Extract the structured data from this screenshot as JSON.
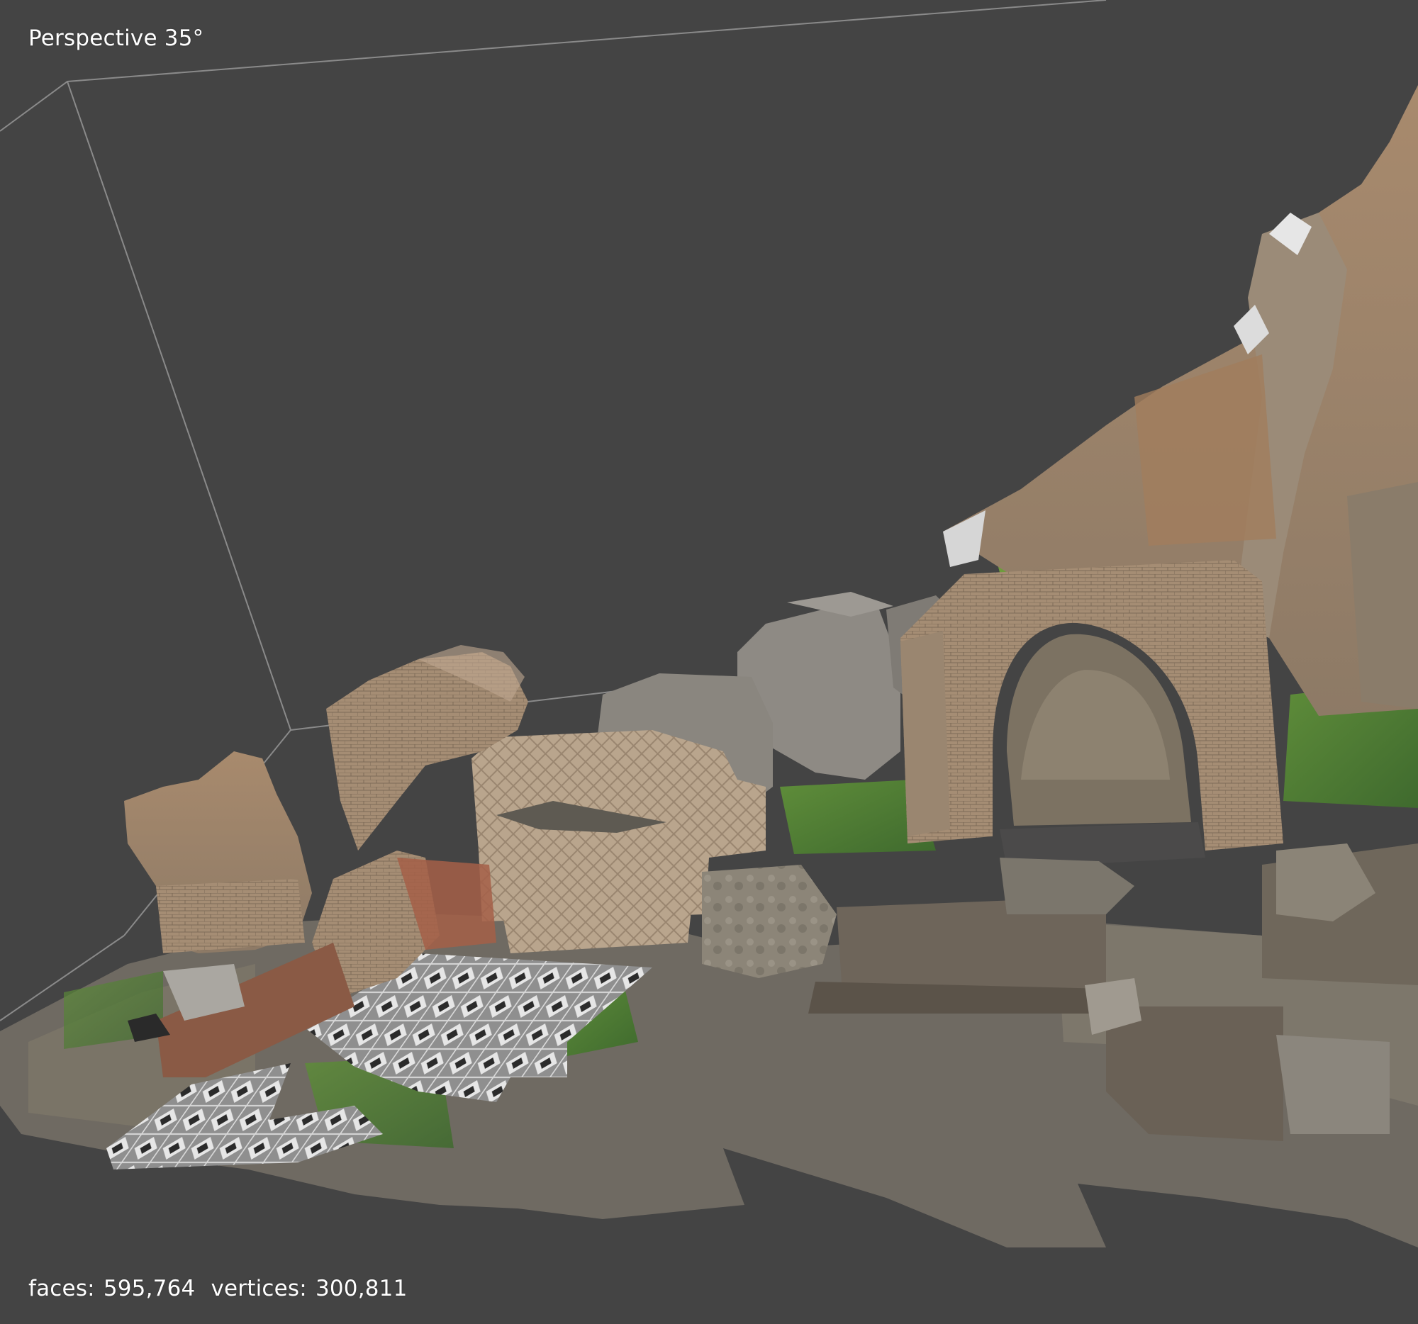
{
  "viewport": {
    "view_mode_label": "Perspective 35°",
    "stats": {
      "faces_label": "faces:",
      "faces_value": "595,764",
      "vertices_label": "vertices:",
      "vertices_value": "300,811"
    }
  },
  "colors": {
    "background": "#444444",
    "grid_line": "#8a8a8a",
    "overlay_text": "#ffffff"
  }
}
